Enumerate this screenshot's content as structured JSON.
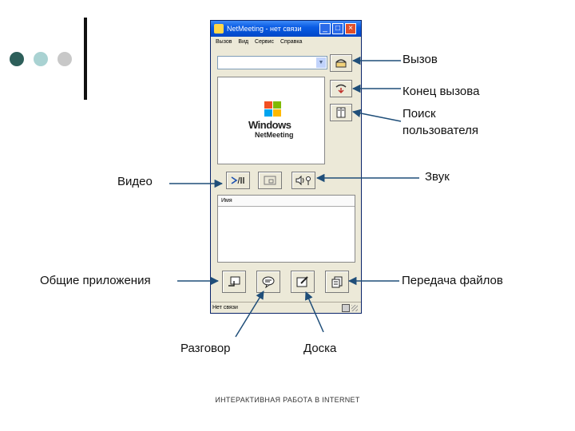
{
  "window": {
    "title": "NetMeeting - нет связи",
    "menu": [
      "Вызов",
      "Вид",
      "Сервис",
      "Справка"
    ],
    "list_header": "Имя",
    "status": "Нет связи",
    "logo_line1": "Windows",
    "logo_line2": "NetMeeting"
  },
  "callouts": {
    "call": "Вызов",
    "end_call": "Конец вызова",
    "find_user_1": "Поиск",
    "find_user_2": "пользователя",
    "video": "Видео",
    "sound": "Звук",
    "share_apps": "Общие приложения",
    "file_transfer": "Передача файлов",
    "chat": "Разговор",
    "whiteboard": "Доска"
  },
  "footer": "ИНТЕРАКТИВНАЯ РАБОТА В INTERNET",
  "colors": {
    "dot1": "#2d5f5a",
    "dot2": "#a9d2d2",
    "dot3": "#c8c8c8",
    "titlebar": "#0a5ce4"
  }
}
